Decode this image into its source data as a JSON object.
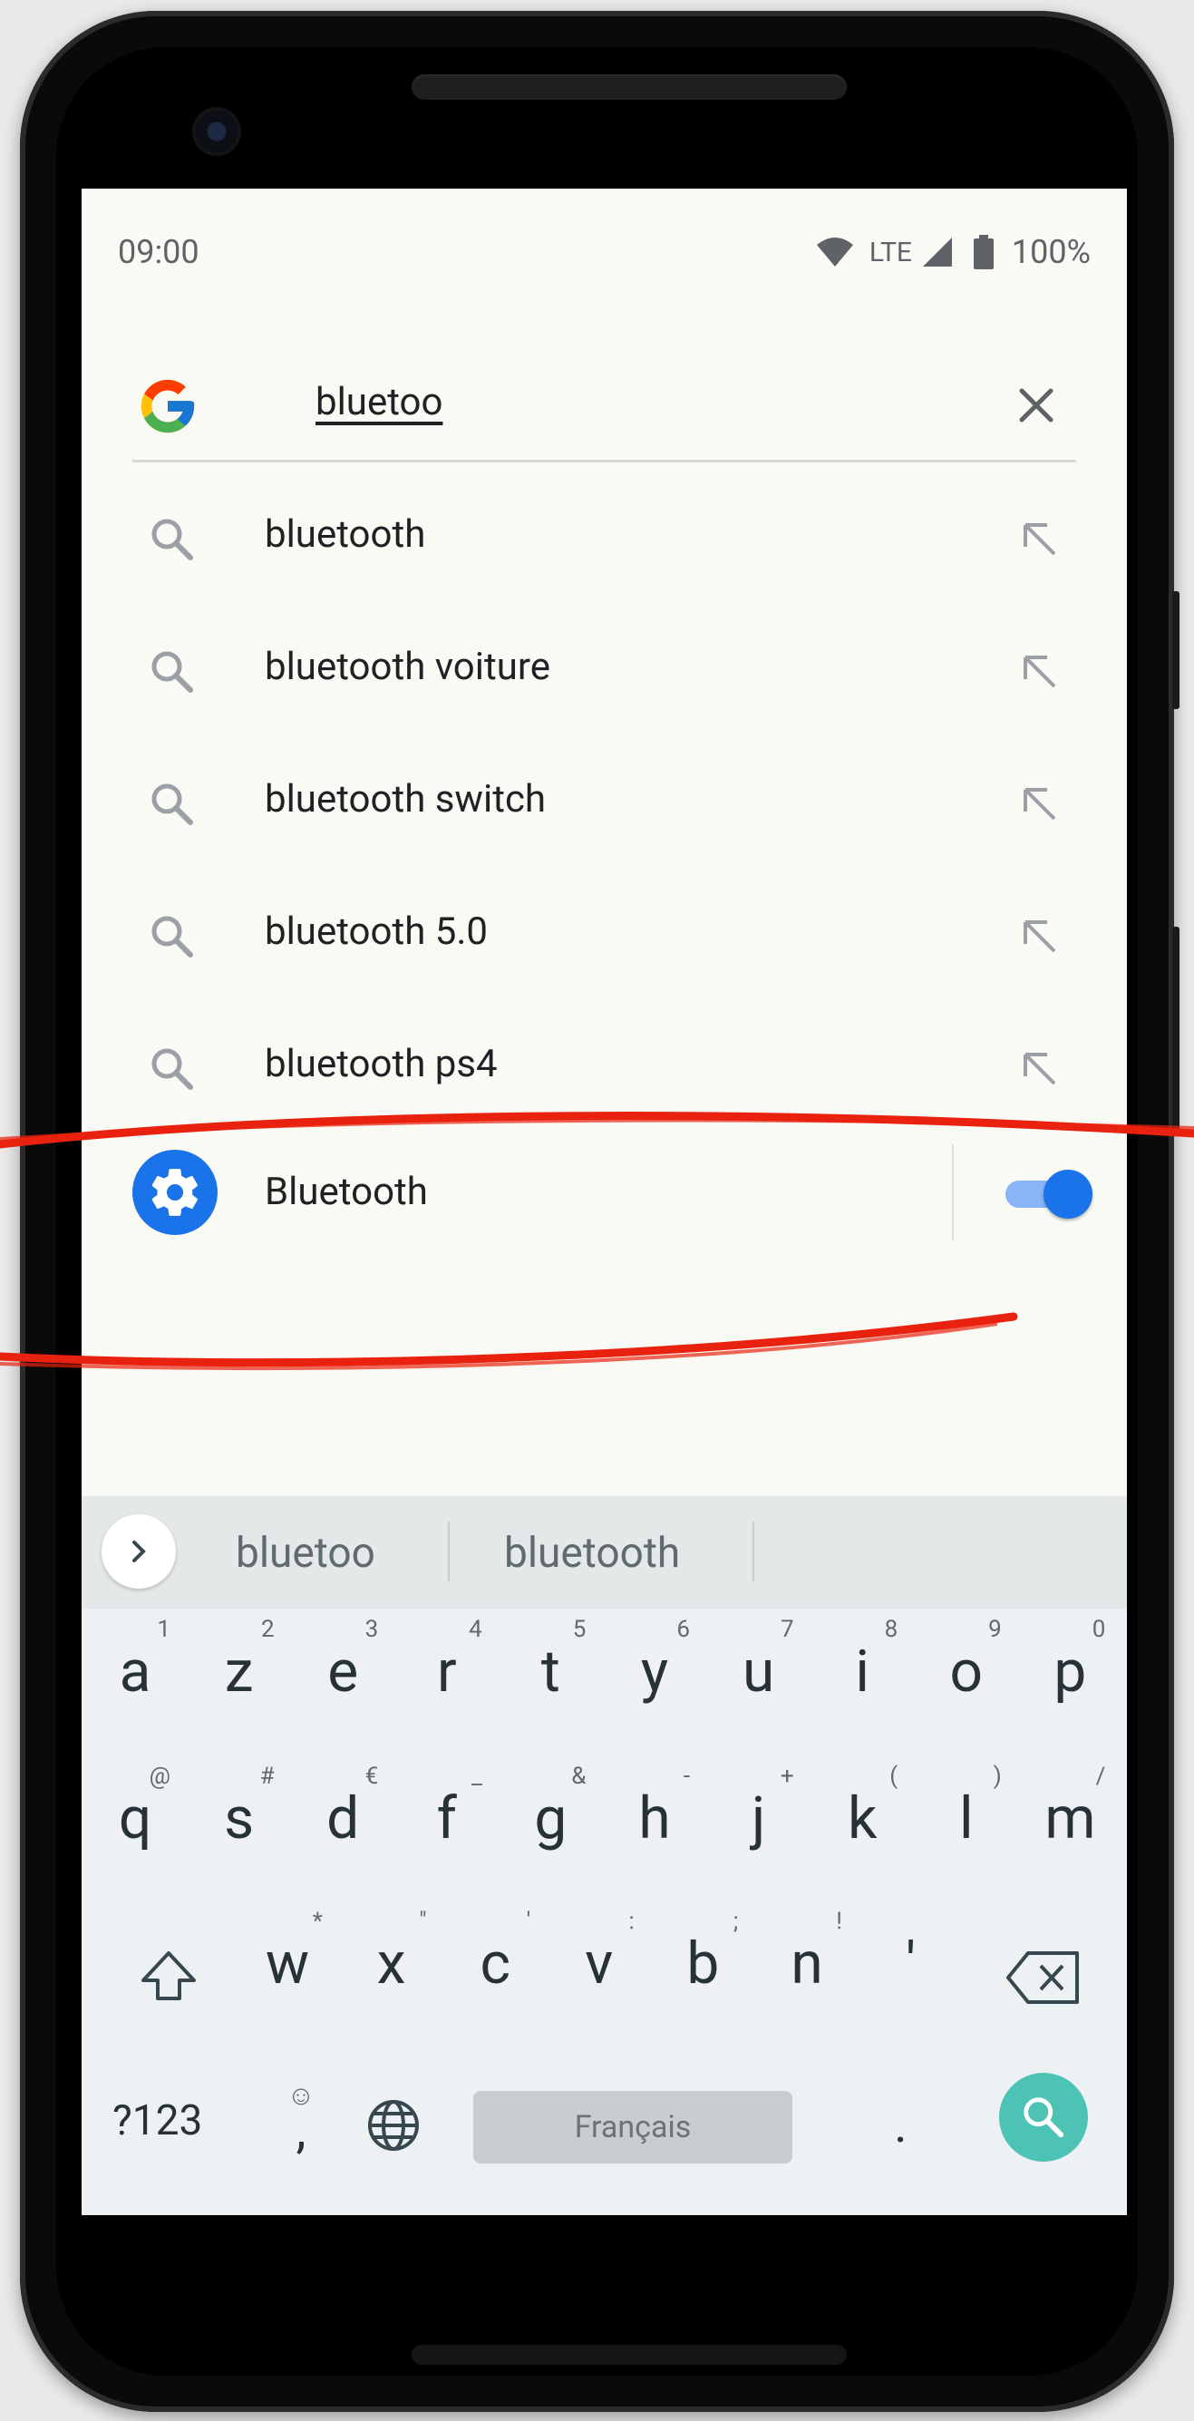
{
  "status_bar": {
    "time": "09:00",
    "network": "LTE",
    "battery": "100%"
  },
  "search": {
    "query": "bluetoo"
  },
  "suggestions": [
    {
      "text": "bluetooth"
    },
    {
      "text": "bluetooth voiture"
    },
    {
      "text": "bluetooth switch"
    },
    {
      "text": "bluetooth 5.0"
    },
    {
      "text": "bluetooth ps4"
    }
  ],
  "setting_result": {
    "label": "Bluetooth",
    "toggle_on": true
  },
  "keyboard": {
    "suggestion_strip": [
      "bluetoo",
      "bluetooth"
    ],
    "row1": [
      {
        "k": "a",
        "s": "1"
      },
      {
        "k": "z",
        "s": "2"
      },
      {
        "k": "e",
        "s": "3"
      },
      {
        "k": "r",
        "s": "4"
      },
      {
        "k": "t",
        "s": "5"
      },
      {
        "k": "y",
        "s": "6"
      },
      {
        "k": "u",
        "s": "7"
      },
      {
        "k": "i",
        "s": "8"
      },
      {
        "k": "o",
        "s": "9"
      },
      {
        "k": "p",
        "s": "0"
      }
    ],
    "row2": [
      {
        "k": "q",
        "s": "@"
      },
      {
        "k": "s",
        "s": "#"
      },
      {
        "k": "d",
        "s": "€"
      },
      {
        "k": "f",
        "s": "_"
      },
      {
        "k": "g",
        "s": "&"
      },
      {
        "k": "h",
        "s": "-"
      },
      {
        "k": "j",
        "s": "+"
      },
      {
        "k": "k",
        "s": "("
      },
      {
        "k": "l",
        "s": ")"
      },
      {
        "k": "m",
        "s": "/"
      }
    ],
    "row3": [
      {
        "k": "w",
        "s": "*"
      },
      {
        "k": "x",
        "s": "\""
      },
      {
        "k": "c",
        "s": "'"
      },
      {
        "k": "v",
        "s": ":"
      },
      {
        "k": "b",
        "s": ";"
      },
      {
        "k": "n",
        "s": "!"
      },
      {
        "k": "'",
        "s": ""
      }
    ],
    "symbols_label": "?123",
    "comma_emoji": "☺",
    "comma": ",",
    "space_label": "Français",
    "period": "."
  },
  "colors": {
    "accent_blue": "#1a73e8",
    "toggle_track": "#8ab4f8",
    "enter_teal": "#4cc3b4",
    "annotation_red": "#e8220f"
  }
}
